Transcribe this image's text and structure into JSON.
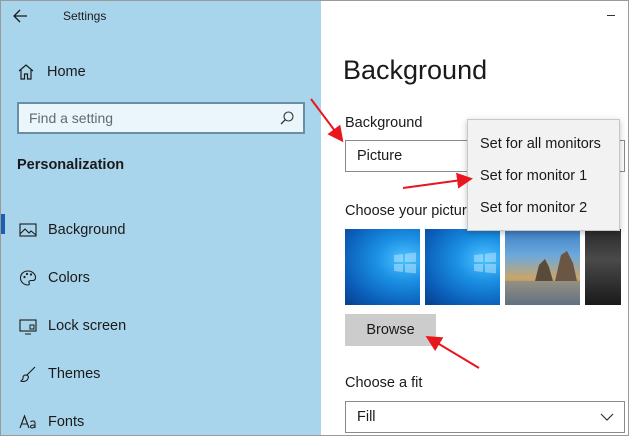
{
  "window": {
    "app_title": "Settings",
    "back_icon": "back-arrow-icon",
    "minimize_icon": "minimize-icon"
  },
  "sidebar": {
    "home_label": "Home",
    "search_placeholder": "Find a setting",
    "section_title": "Personalization",
    "items": [
      {
        "label": "Background",
        "icon": "picture-icon",
        "active": true
      },
      {
        "label": "Colors",
        "icon": "palette-icon",
        "active": false
      },
      {
        "label": "Lock screen",
        "icon": "lock-screen-icon",
        "active": false
      },
      {
        "label": "Themes",
        "icon": "brush-icon",
        "active": false
      },
      {
        "label": "Fonts",
        "icon": "font-icon",
        "active": false
      }
    ]
  },
  "main": {
    "page_title": "Background",
    "background_label": "Background",
    "background_value": "Picture",
    "choose_picture_label": "Choose your pictur",
    "browse_label": "Browse",
    "fit_label": "Choose a fit",
    "fit_value": "Fill"
  },
  "context_menu": {
    "items": [
      "Set for all monitors",
      "Set for monitor 1",
      "Set for monitor 2"
    ]
  },
  "colors": {
    "sidebar_bg": "#a9d5ec",
    "accent": "#1a5fb4",
    "annotation_arrow": "#e8161d"
  }
}
